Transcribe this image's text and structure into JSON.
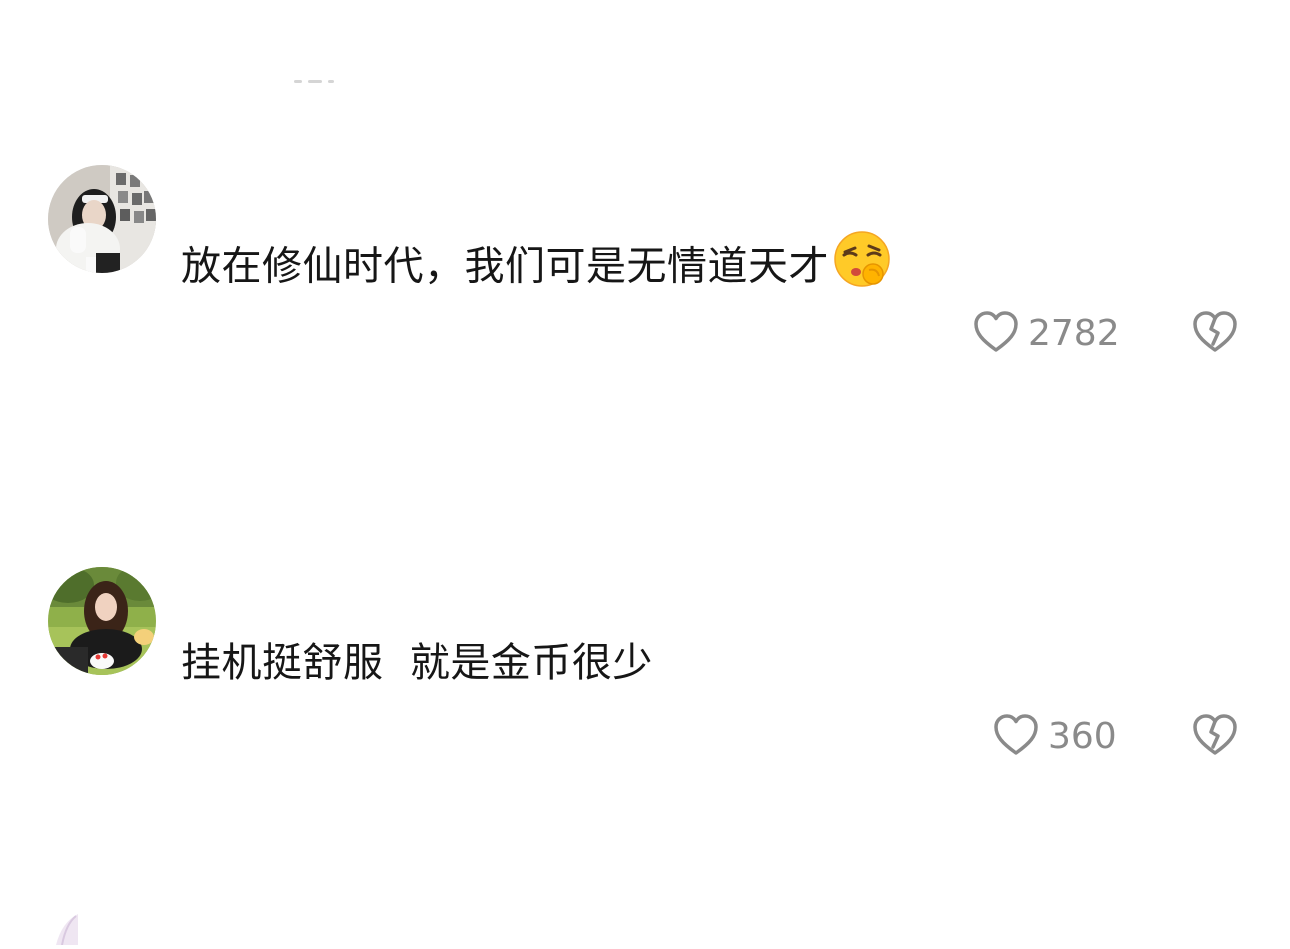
{
  "comments": [
    {
      "text": "放在修仙时代，我们可是无情道天才",
      "emoji": "shushing-kiss-face",
      "likes": "2782"
    },
    {
      "text": "挂机挺舒服  就是金币很少",
      "likes": "360"
    }
  ],
  "colors": {
    "text": "#161616",
    "meta": "#8a8a8a",
    "background": "#ffffff"
  }
}
